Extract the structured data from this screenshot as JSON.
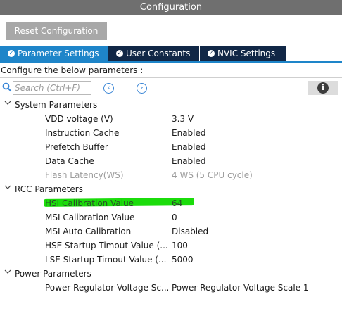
{
  "window": {
    "title": "Configuration"
  },
  "toolbar": {
    "reset_label": "Reset Configuration"
  },
  "tabs": [
    {
      "label": "Parameter Settings",
      "active": true
    },
    {
      "label": "User Constants",
      "active": false
    },
    {
      "label": "NVIC Settings",
      "active": false
    }
  ],
  "configure_text": "Configure the below parameters :",
  "search": {
    "placeholder": "Search (Ctrl+F)",
    "value": ""
  },
  "colors": {
    "active_tab": "#1e85c9",
    "inactive_tab": "#112746",
    "highlight": "#1bdc0b",
    "titlebar": "#6f6f6f"
  },
  "groups": [
    {
      "label": "System Parameters",
      "expanded": true,
      "params": [
        {
          "name": "VDD voltage (V)",
          "value": "3.3 V"
        },
        {
          "name": "Instruction Cache",
          "value": "Enabled"
        },
        {
          "name": "Prefetch Buffer",
          "value": "Enabled"
        },
        {
          "name": "Data Cache",
          "value": "Enabled"
        },
        {
          "name": "Flash Latency(WS)",
          "value": "4 WS (5 CPU cycle)",
          "disabled": true
        }
      ]
    },
    {
      "label": "RCC Parameters",
      "expanded": true,
      "params": [
        {
          "name": "HSI Calibration Value",
          "value": "64",
          "highlighted": true
        },
        {
          "name": "MSI Calibration Value",
          "value": "0"
        },
        {
          "name": "MSI Auto Calibration",
          "value": "Disabled"
        },
        {
          "name": "HSE Startup Timout Value (...",
          "value": "100"
        },
        {
          "name": "LSE Startup Timout Value (...",
          "value": "5000"
        }
      ]
    },
    {
      "label": "Power Parameters",
      "expanded": true,
      "params": [
        {
          "name": "Power Regulator Voltage Sc...",
          "value": "Power Regulator Voltage Scale 1"
        }
      ]
    }
  ]
}
